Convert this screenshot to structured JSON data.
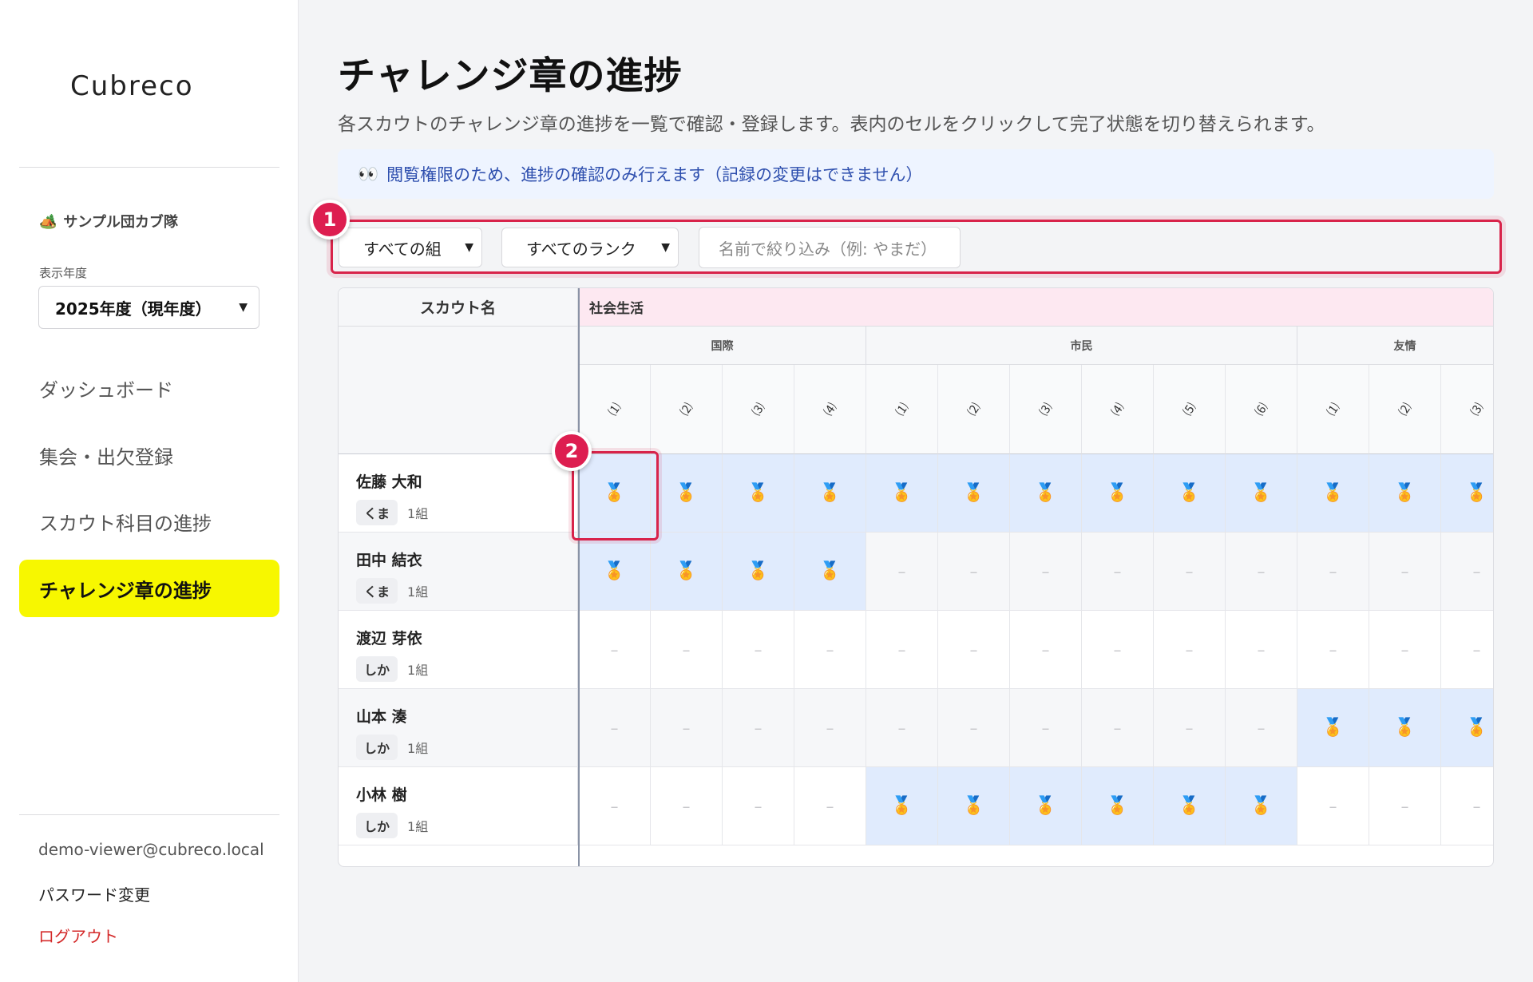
{
  "sidebar": {
    "logo": "Cubreco",
    "org": {
      "icon": "🏕️",
      "name": "サンプル団カブ隊"
    },
    "year_label": "表示年度",
    "year_value": "2025年度（現年度）",
    "nav": [
      {
        "label": "ダッシュボード",
        "active": false
      },
      {
        "label": "集会・出欠登録",
        "active": false
      },
      {
        "label": "スカウト科目の進捗",
        "active": false
      },
      {
        "label": "チャレンジ章の進捗",
        "active": true
      }
    ],
    "user_email": "demo-viewer@cubreco.local",
    "password_link": "パスワード変更",
    "logout_link": "ログアウト"
  },
  "main": {
    "title": "チャレンジ章の進捗",
    "subtitle": "各スカウトのチャレンジ章の進捗を一覧で確認・登録します。表内のセルをクリックして完了状態を切り替えられます。",
    "notice_icon": "👀",
    "notice": "閲覧権限のため、進捗の確認のみ行えます（記録の変更はできません）",
    "filters": {
      "group": "すべての組",
      "rank": "すべてのランク",
      "name_placeholder": "名前で絞り込み（例: やまだ）"
    },
    "annotations": [
      "1",
      "2"
    ],
    "table": {
      "scout_header": "スカウト名",
      "category": "社会生活",
      "groups": [
        {
          "name": "国際",
          "items": [
            "⑴",
            "⑵",
            "⑶",
            "⑷"
          ]
        },
        {
          "name": "市民",
          "items": [
            "⑴",
            "⑵",
            "⑶",
            "⑷",
            "⑸",
            "⑹"
          ]
        },
        {
          "name": "友情",
          "items": [
            "⑴",
            "⑵",
            "⑶"
          ]
        }
      ],
      "done_icon": "🏅",
      "empty_mark": "–",
      "rows": [
        {
          "name": "佐藤 大和",
          "rank": "くま",
          "group": "1組",
          "done": [
            1,
            1,
            1,
            1,
            1,
            1,
            1,
            1,
            1,
            1,
            1,
            1,
            1
          ]
        },
        {
          "name": "田中 結衣",
          "rank": "くま",
          "group": "1組",
          "done": [
            1,
            1,
            1,
            1,
            0,
            0,
            0,
            0,
            0,
            0,
            0,
            0,
            0
          ]
        },
        {
          "name": "渡辺 芽依",
          "rank": "しか",
          "group": "1組",
          "done": [
            0,
            0,
            0,
            0,
            0,
            0,
            0,
            0,
            0,
            0,
            0,
            0,
            0
          ]
        },
        {
          "name": "山本 湊",
          "rank": "しか",
          "group": "1組",
          "done": [
            0,
            0,
            0,
            0,
            0,
            0,
            0,
            0,
            0,
            0,
            1,
            1,
            1
          ]
        },
        {
          "name": "小林 樹",
          "rank": "しか",
          "group": "1組",
          "done": [
            0,
            0,
            0,
            0,
            1,
            1,
            1,
            1,
            1,
            1,
            0,
            0,
            0
          ]
        }
      ]
    }
  }
}
